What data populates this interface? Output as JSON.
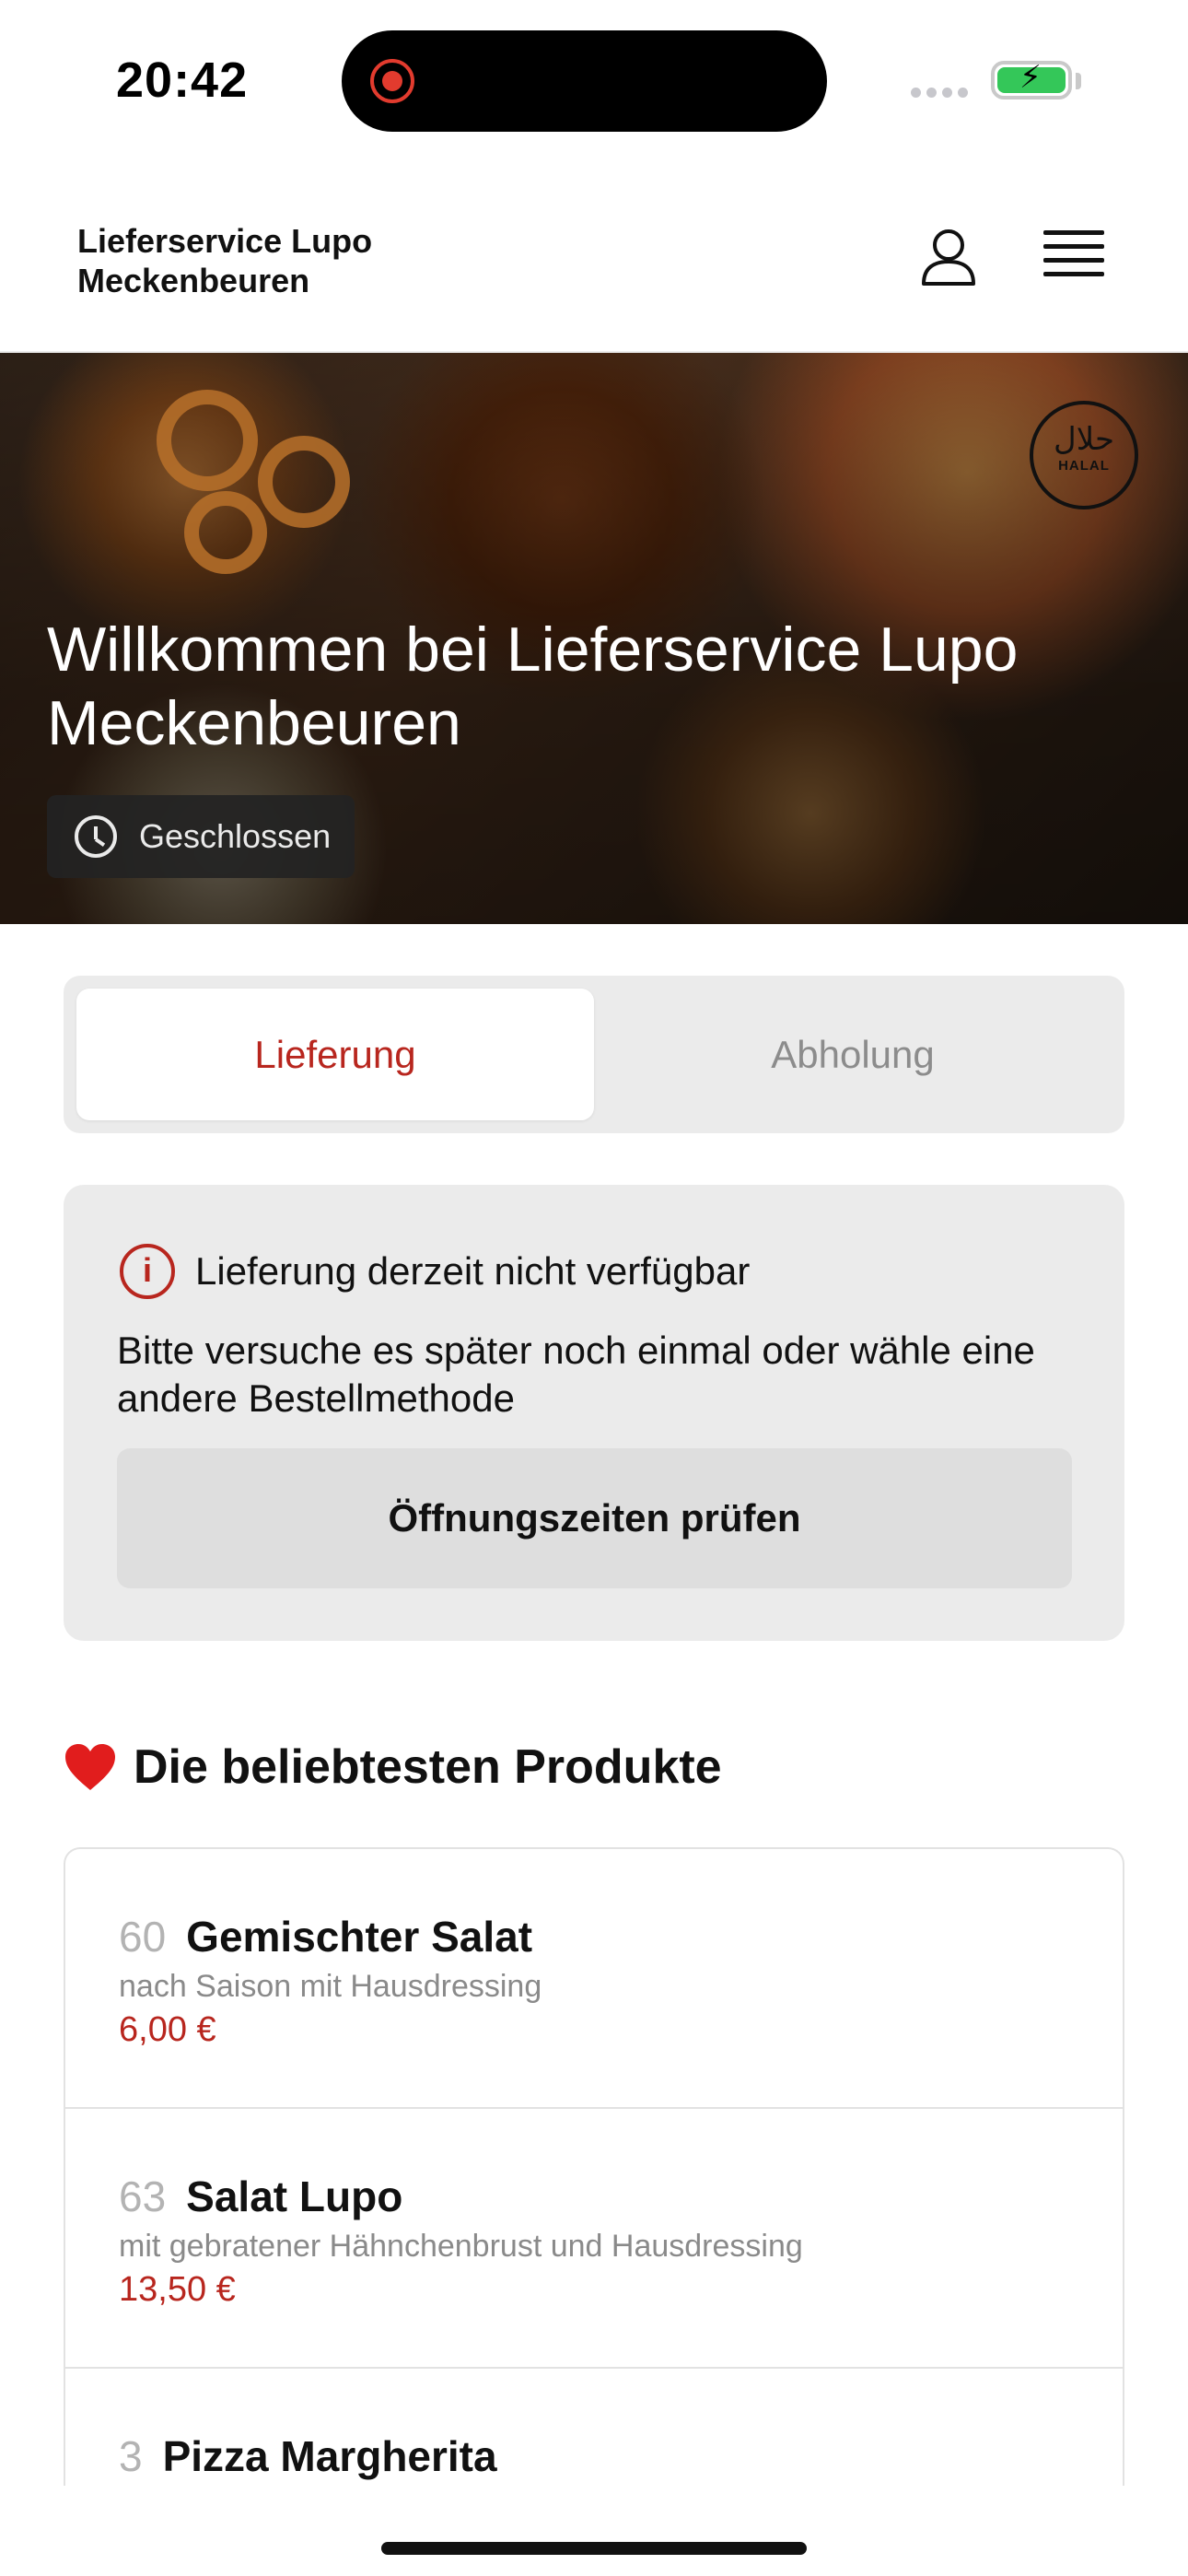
{
  "status_bar": {
    "time": "20:42"
  },
  "header": {
    "brand_line1": "Lieferservice Lupo",
    "brand_line2": "Meckenbeuren",
    "icons": [
      "user-icon",
      "menu-icon"
    ]
  },
  "hero": {
    "title": "Willkommen bei Lieferservice Lupo Meckenbeuren",
    "status": "Geschlossen",
    "halal_ar": "حلال",
    "halal_en": "HALAL"
  },
  "order_mode": {
    "delivery_label": "Lieferung",
    "pickup_label": "Abholung",
    "selected": "Lieferung"
  },
  "notice": {
    "title": "Lieferung derzeit nicht verfügbar",
    "text": "Bitte versuche es später noch einmal oder wähle eine andere Bestellmethode",
    "button_label": "Öffnungszeiten prüfen"
  },
  "popular": {
    "title": "Die beliebtesten Produkte",
    "products": [
      {
        "number": "60",
        "name": "Gemischter Salat",
        "description": "nach Saison mit Hausdressing",
        "price": "6,00 €"
      },
      {
        "number": "63",
        "name": "Salat Lupo",
        "description": "mit gebratener Hähnchenbrust und Hausdressing",
        "price": "13,50 €"
      },
      {
        "number": "3",
        "name": "Pizza Margherita",
        "description": "",
        "price": ""
      }
    ]
  },
  "colors": {
    "accent": "#b8261e",
    "battery": "#34c759"
  }
}
